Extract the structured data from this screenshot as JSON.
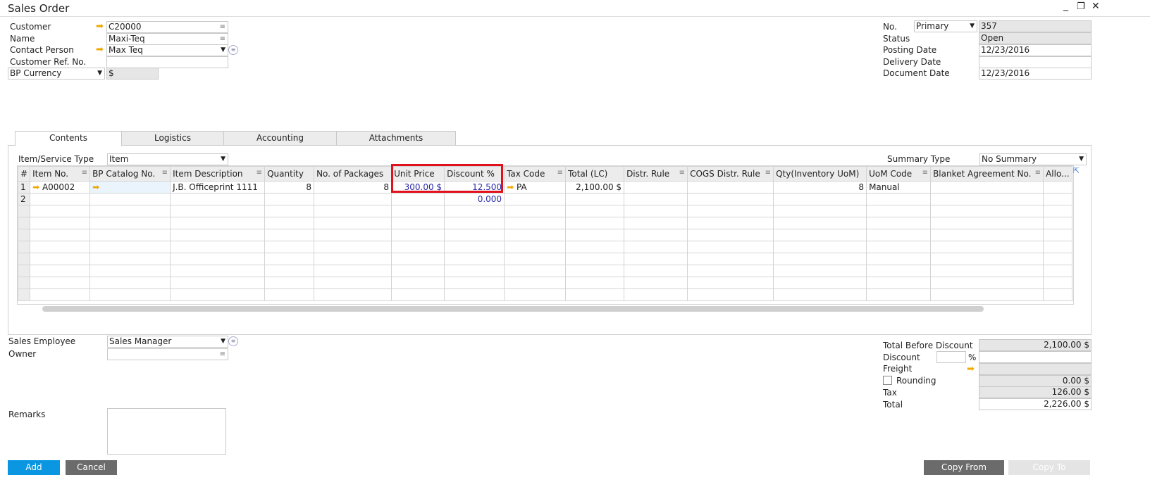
{
  "window": {
    "title": "Sales Order"
  },
  "header_left": {
    "customer_label": "Customer",
    "customer": "C20000",
    "name_label": "Name",
    "name": "Maxi-Teq",
    "contact_label": "Contact Person",
    "contact": "Max Teq",
    "ref_label": "Customer Ref. No.",
    "ref": "",
    "currency_select": "BP Currency",
    "currency": "$"
  },
  "header_right": {
    "no_label": "No.",
    "series": "Primary",
    "no": "357",
    "status_label": "Status",
    "status": "Open",
    "posting_label": "Posting Date",
    "posting": "12/23/2016",
    "delivery_label": "Delivery Date",
    "delivery": "",
    "document_label": "Document Date",
    "document": "12/23/2016"
  },
  "tabs": [
    {
      "label": "Contents",
      "active": true
    },
    {
      "label": "Logistics"
    },
    {
      "label": "Accounting"
    },
    {
      "label": "Attachments"
    }
  ],
  "contents": {
    "type_label": "Item/Service Type",
    "type": "Item",
    "summary_label": "Summary Type",
    "summary": "No Summary",
    "columns": [
      "#",
      "Item No.",
      "BP Catalog No.",
      "Item Description",
      "Quantity",
      "No. of Packages",
      "Unit Price",
      "Discount %",
      "Tax Code",
      "Total (LC)",
      "Distr. Rule",
      "COGS Distr. Rule",
      "Qty(Inventory UoM)",
      "UoM Code",
      "Blanket Agreement No.",
      "Allo..."
    ],
    "rows": [
      [
        "1",
        "A00002",
        "",
        "J.B. Officeprint 1111",
        "8",
        "8",
        "300.00 $",
        "12.500",
        "PA",
        "2,100.00 $",
        "",
        "",
        "8",
        "Manual",
        "",
        ""
      ],
      [
        "2",
        "",
        "",
        "",
        "",
        "",
        "",
        "0.000",
        "",
        "",
        "",
        "",
        "",
        "",
        "",
        ""
      ]
    ],
    "highlight_color": "#e0101c"
  },
  "footer_left": {
    "employee_label": "Sales Employee",
    "employee": "Sales Manager",
    "owner_label": "Owner",
    "owner": "",
    "remarks_label": "Remarks",
    "remarks": ""
  },
  "totals": {
    "before_label": "Total Before Discount",
    "before": "2,100.00 $",
    "discount_label": "Discount",
    "discount_pct": "",
    "pct_sign": "%",
    "discount": "",
    "freight_label": "Freight",
    "freight": "",
    "rounding_label": "Rounding",
    "rounding": "0.00 $",
    "tax_label": "Tax",
    "tax": "126.00 $",
    "total_label": "Total",
    "total": "2,226.00 $"
  },
  "buttons": {
    "add": "Add",
    "cancel": "Cancel",
    "copy_from": "Copy From",
    "copy_to": "Copy To"
  },
  "colors": {
    "accent": "#0a96e0",
    "dark_button": "#6b6b6b",
    "arrow": "#f0a800"
  }
}
